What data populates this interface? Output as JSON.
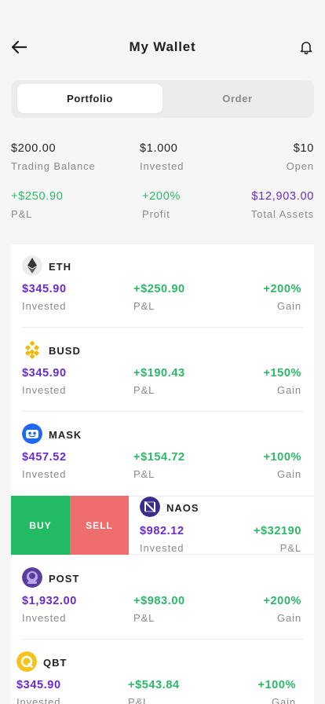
{
  "header": {
    "title": "My Wallet",
    "back_icon": "arrow-left-icon",
    "notification_icon": "bell-icon"
  },
  "tabs": [
    {
      "label": "Portfolio",
      "active": true
    },
    {
      "label": "Order",
      "active": false
    }
  ],
  "summary": {
    "row1": [
      {
        "value": "$200.00",
        "label": "Trading Balance"
      },
      {
        "value": "$1.000",
        "label": "Invested"
      },
      {
        "value": "$10",
        "label": "Open"
      }
    ],
    "row2": [
      {
        "value": "+$250.90",
        "label": "P&L",
        "color": "#2cb867"
      },
      {
        "value": "+200%",
        "label": "Profit",
        "color": "#2cb867"
      },
      {
        "value": "$12,903.00",
        "label": "Total Assets",
        "color": "#6a2bcf"
      }
    ]
  },
  "assets": [
    {
      "name": "ETH",
      "icon": "ethereum-icon",
      "invested": "$345.90",
      "invested_label": "Invested",
      "pnl": "+$250.90",
      "pnl_label": "P&L",
      "gain": "+200%",
      "gain_label": "Gain"
    },
    {
      "name": "BUSD",
      "icon": "busd-icon",
      "invested": "$345.90",
      "invested_label": "Invested",
      "pnl": "+$190.43",
      "pnl_label": "P&L",
      "gain": "+150%",
      "gain_label": "Gain"
    },
    {
      "name": "MASK",
      "icon": "mask-icon",
      "invested": "$457.52",
      "invested_label": "Invested",
      "pnl": "+$154.72",
      "pnl_label": "P&L",
      "gain": "+100%",
      "gain_label": "Gain"
    },
    {
      "name": "NAOS",
      "icon": "naos-icon",
      "invested": "$982.12",
      "invested_label": "Invested",
      "pnl": "+$32190",
      "pnl_label": "P&L",
      "swiped": true,
      "buy_label": "BUY",
      "sell_label": "SELL"
    },
    {
      "name": "POST",
      "icon": "post-icon",
      "invested": "$1,932.00",
      "invested_label": "Invested",
      "pnl": "+$983.00",
      "pnl_label": "P&L",
      "gain": "+200%",
      "gain_label": "Gain"
    },
    {
      "name": "QBT",
      "icon": "qbt-icon",
      "invested": "$345.90",
      "invested_label": "Invested",
      "pnl": "+$543.84",
      "pnl_label": "P&L",
      "gain": "+100%",
      "gain_label": "Gain"
    }
  ],
  "colors": {
    "positive": "#2cb867",
    "accent": "#6a2bcf",
    "buy": "#22ba63",
    "sell": "#ef6d6d"
  }
}
